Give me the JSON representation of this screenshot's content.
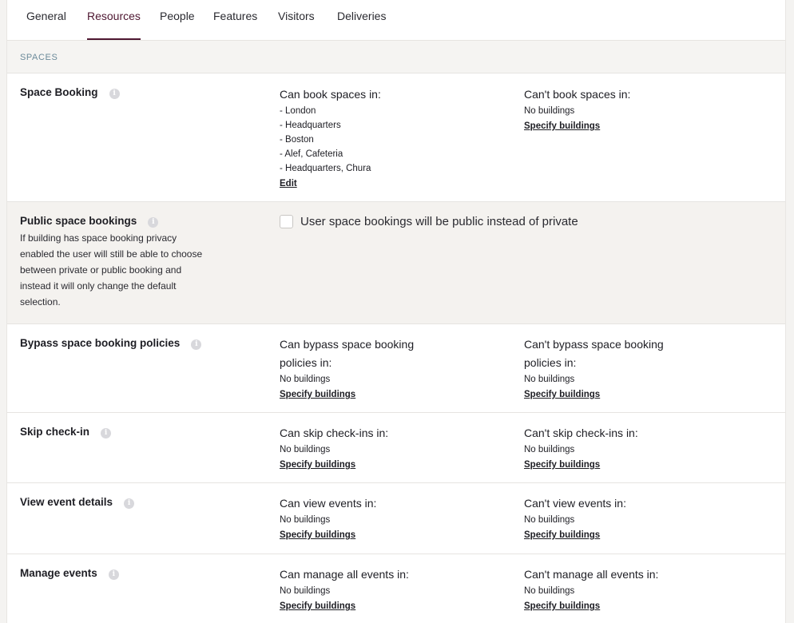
{
  "tabs": [
    {
      "label": "General"
    },
    {
      "label": "Resources"
    },
    {
      "label": "People"
    },
    {
      "label": "Features"
    },
    {
      "label": "Visitors"
    },
    {
      "label": "Deliveries"
    }
  ],
  "active_tab": "Resources",
  "section": {
    "title": "SPACES"
  },
  "rows": {
    "space_booking": {
      "title": "Space Booking",
      "can_head": "Can book spaces in:",
      "can_items": [
        "- London",
        "- Headquarters",
        "- Boston",
        "- Alef, Cafeteria",
        "- Headquarters, Chura"
      ],
      "can_link": "Edit",
      "cant_head": "Can't book spaces in:",
      "cant_text": "No buildings",
      "cant_link": "Specify buildings"
    },
    "public_bookings": {
      "title": "Public space bookings",
      "description": "If building has space booking privacy enabled the user will still be able to choose between private or public booking and instead it will only change the default selection.",
      "checkbox_label": "User space bookings will be public instead of private",
      "checked": false
    },
    "bypass_policies": {
      "title": "Bypass space booking policies",
      "can_head": "Can bypass space booking policies in:",
      "can_text": "No buildings",
      "can_link": "Specify buildings",
      "cant_head": "Can't bypass space booking policies in:",
      "cant_text": "No buildings",
      "cant_link": "Specify buildings"
    },
    "skip_checkin": {
      "title": "Skip check-in",
      "can_head": "Can skip check-ins in:",
      "can_text": "No buildings",
      "can_link": "Specify buildings",
      "cant_head": "Can't skip check-ins in:",
      "cant_text": "No buildings",
      "cant_link": "Specify buildings"
    },
    "view_events": {
      "title": "View event details",
      "can_head": "Can view events in:",
      "can_text": "No buildings",
      "can_link": "Specify buildings",
      "cant_head": "Can't view events in:",
      "cant_text": "No buildings",
      "cant_link": "Specify buildings"
    },
    "manage_events": {
      "title": "Manage events",
      "can_head": "Can manage all events in:",
      "can_text": "No buildings",
      "can_link": "Specify buildings",
      "cant_head": "Can't manage all events in:",
      "cant_text": "No buildings",
      "cant_link": "Specify buildings"
    }
  },
  "icons": {
    "info": "info-icon"
  },
  "colors": {
    "accent": "#4e1731",
    "section_text": "#6b8a9a",
    "shaded_row": "#f4f2ef"
  }
}
